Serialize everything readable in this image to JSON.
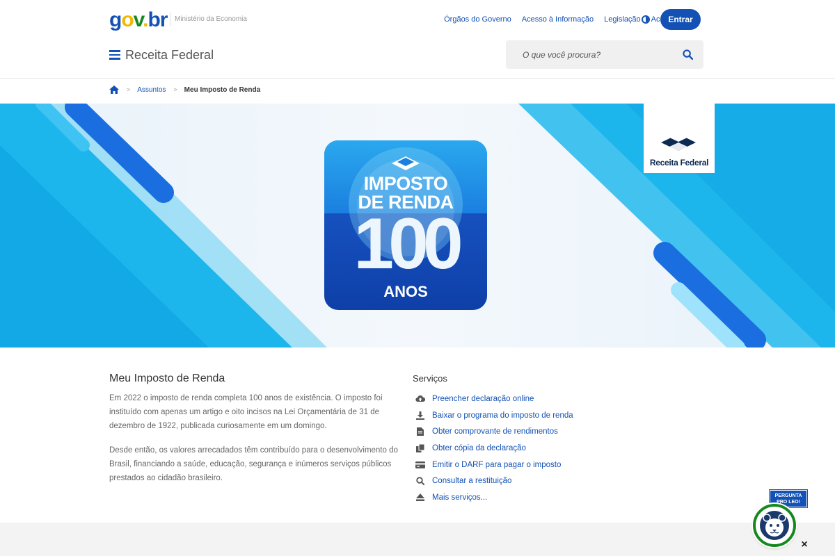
{
  "header": {
    "logo": {
      "g": "g",
      "o": "o",
      "v": "v",
      "dot": ".",
      "b": "br"
    },
    "ministry": "Ministério da Economia",
    "top_links": [
      "Órgãos do Governo",
      "Acesso à Informação",
      "Legislação",
      "Acessibilidade"
    ],
    "login_label": "Entrar",
    "site_title": "Receita Federal",
    "search_placeholder": "O que você procura?"
  },
  "breadcrumb": {
    "items": [
      "Assuntos"
    ],
    "current": "Meu Imposto de Renda"
  },
  "banner": {
    "badge_title_line1": "IMPOSTO",
    "badge_title_line2": "DE RENDA",
    "badge_number": "100",
    "badge_subtitle": "ANOS",
    "corner_logo_text": "Receita Federal"
  },
  "content": {
    "title": "Meu Imposto de Renda",
    "paragraphs": [
      "Em 2022 o imposto de renda completa 100 anos de existência. O imposto foi instituído com apenas um artigo e oito incisos na Lei Orçamentária de 31 de dezembro de 1922, publicada curiosamente em um domingo.",
      "Desde então, os valores arrecadados têm contribuído para o desenvolvimento do Brasil, financiando a saúde, educação, segurança e inúmeros serviços públicos prestados ao cidadão brasileiro."
    ]
  },
  "services": {
    "title": "Serviços",
    "items": [
      {
        "label": "Preencher declaração online",
        "icon": "cloud-upload-icon"
      },
      {
        "label": "Baixar o programa do imposto de renda",
        "icon": "download-icon"
      },
      {
        "label": "Obter comprovante de rendimentos",
        "icon": "document-icon"
      },
      {
        "label": "Obter cópia da declaração",
        "icon": "copy-icon"
      },
      {
        "label": "Emitir o DARF para pagar o imposto",
        "icon": "credit-card-icon"
      },
      {
        "label": "Consultar a restituição",
        "icon": "search-icon"
      },
      {
        "label": "Mais serviços...",
        "icon": "eject-icon"
      }
    ]
  },
  "chat": {
    "badge_line1": "PERGUNTA",
    "badge_line2": "PRO LEO!",
    "close_label": "×"
  },
  "colors": {
    "primary": "#1351b4",
    "gov_yellow": "#f3b803",
    "gov_green": "#168821",
    "banner_cyan": "#1fb6ea"
  }
}
